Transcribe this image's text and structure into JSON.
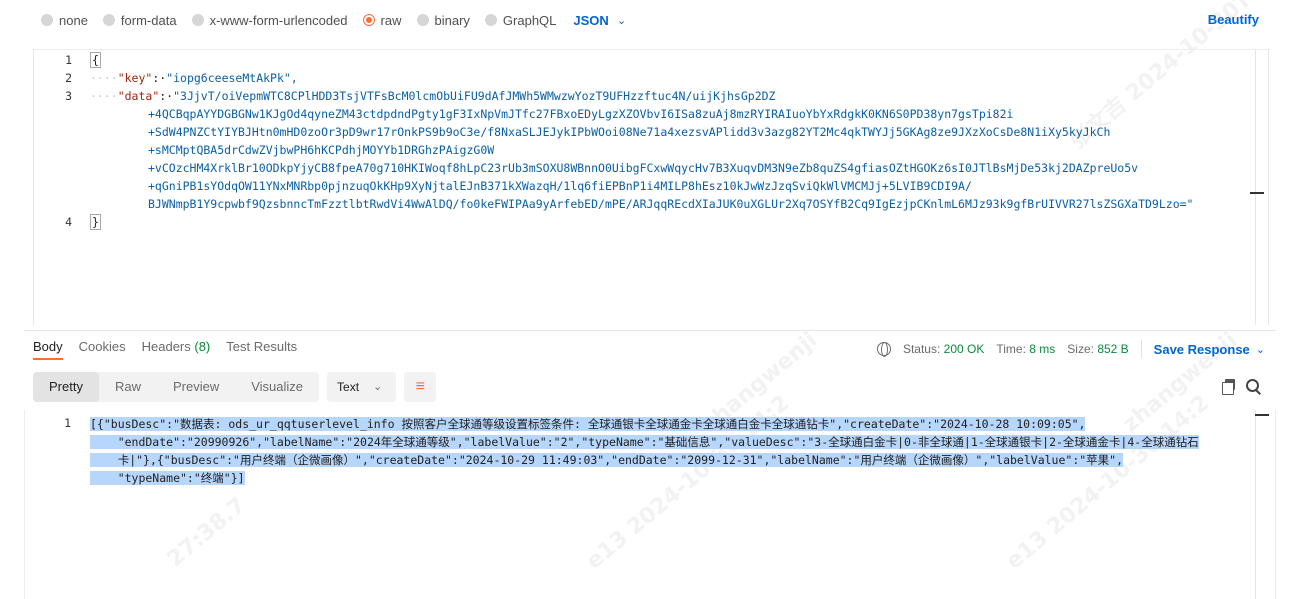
{
  "body_types": [
    {
      "label": "none",
      "selected": false
    },
    {
      "label": "form-data",
      "selected": false
    },
    {
      "label": "x-www-form-urlencoded",
      "selected": false
    },
    {
      "label": "raw",
      "selected": true
    },
    {
      "label": "binary",
      "selected": false
    },
    {
      "label": "GraphQL",
      "selected": false
    }
  ],
  "format_selector": "JSON",
  "beautify_label": "Beautify",
  "request": {
    "line_numbers": [
      "1",
      "2",
      "3",
      "4"
    ],
    "open_brace": "{",
    "close_brace": "}",
    "key_name": "\"key\"",
    "key_value": "\"iopg6ceeseMtAkPk\",",
    "data_name": "\"data\"",
    "data_lines": [
      "\"3JjvT/oiVepmWTC8CPlHDD3TsjVTFsBcM0lcmObUiFU9dAfJMWh5WMwzwYozT9UFHzzftuc4N/uijKjhsGp2DZ",
      "+4QCBqpAYYDGBGNw1KJgOd4qyneZM43ctdpdndPgty1gF3IxNpVmJTfc27FBxoEDyLgzXZOVbvI6ISa8zuAj8mzRYIRAIuoYbYxRdgkK0KN6S0PD38yn7gsTpi82i",
      "+SdW4PNZCtYIYBJHtn0mHD0zoOr3pD9wr17rOnkPS9b9oC3e/f8NxaSLJEJykIPbWOoi08Ne71a4xezsvAPlidd3v3azg82YT2Mc4qkTWYJj5GKAg8ze9JXzXoCsDe8N1iXy5kyJkCh",
      "+sMCMptQBA5drCdwZVjbwPH6hKCPdhjMOYYb1DRGhzPAigzG0W",
      "+vCOzcHM4XrklBr10ODkpYjyCB8fpeA70g710HKIWoqf8hLpC23rUb3mSOXU8WBnnO0UibgFCxwWqycHv7B3XuqvDM3N9eZb8quZS4gfiasOZtHGOKz6sI0JTlBsMjDe53kj2DAZpreUo5v",
      "+qGniPB1sYOdqOW11YNxMNRbp0pjnzuqOkKHp9XyNjtalEJnB371kXWazqH/1lq6fiEPBnP1i4MILP8hEsz10kJwWzJzqSviQkWlVMCMJj+5LVIB9CDI9A/",
      "BJWNmpB1Y9cpwbf9QzsbnncTmFzztlbtRwdVi4WwAlDQ/fo0keFWIPAa9yArfebED/mPE/ARJqqREcdXIaJUK0uXGLUr2Xq7OSYfB2Cq9IgEzjpCKnlmL6MJz93k9gfBrUIVVR27lsZSGXaTD9Lzo=\""
    ]
  },
  "response_tabs": [
    {
      "label": "Body",
      "active": true
    },
    {
      "label": "Cookies",
      "active": false
    },
    {
      "label": "Headers",
      "count": "(8)",
      "active": false
    },
    {
      "label": "Test Results",
      "active": false
    }
  ],
  "status": {
    "status_label": "Status:",
    "status_value": "200 OK",
    "time_label": "Time:",
    "time_value": "8 ms",
    "size_label": "Size:",
    "size_value": "852 B",
    "save_label": "Save Response"
  },
  "view_modes": [
    {
      "label": "Pretty",
      "active": true
    },
    {
      "label": "Raw",
      "active": false
    },
    {
      "label": "Preview",
      "active": false
    },
    {
      "label": "Visualize",
      "active": false
    }
  ],
  "text_format": "Text",
  "response": {
    "line_number": "1",
    "lines": [
      "[{\"busDesc\":\"数据表: ods_ur_qqtuserlevel_info 按照客户全球通等级设置标签条件: 全球通银卡全球通金卡全球通白金卡全球通钻卡\",\"createDate\":\"2024-10-28 10:09:05\",",
      "    \"endDate\":\"20990926\",\"labelName\":\"2024年全球通等级\",\"labelValue\":\"2\",\"typeName\":\"基础信息\",\"valueDesc\":\"3-全球通白金卡|0-非全球通|1-全球通银卡|2-全球通金卡|4-全球通钻石",
      "    卡|\"},{\"busDesc\":\"用户终端（企微画像）\",\"createDate\":\"2024-10-29 11:49:03\",\"endDate\":\"2099-12-31\",\"labelName\":\"用户终端（企微画像）\",\"labelValue\":\"苹果\",",
      "    \"typeName\":\"终端\"}]"
    ]
  },
  "watermark": [
    "张文吉 2024-10-30T14:",
    "e13 2024-10-30 14:2",
    "zhangwenji",
    "27:38.7"
  ]
}
